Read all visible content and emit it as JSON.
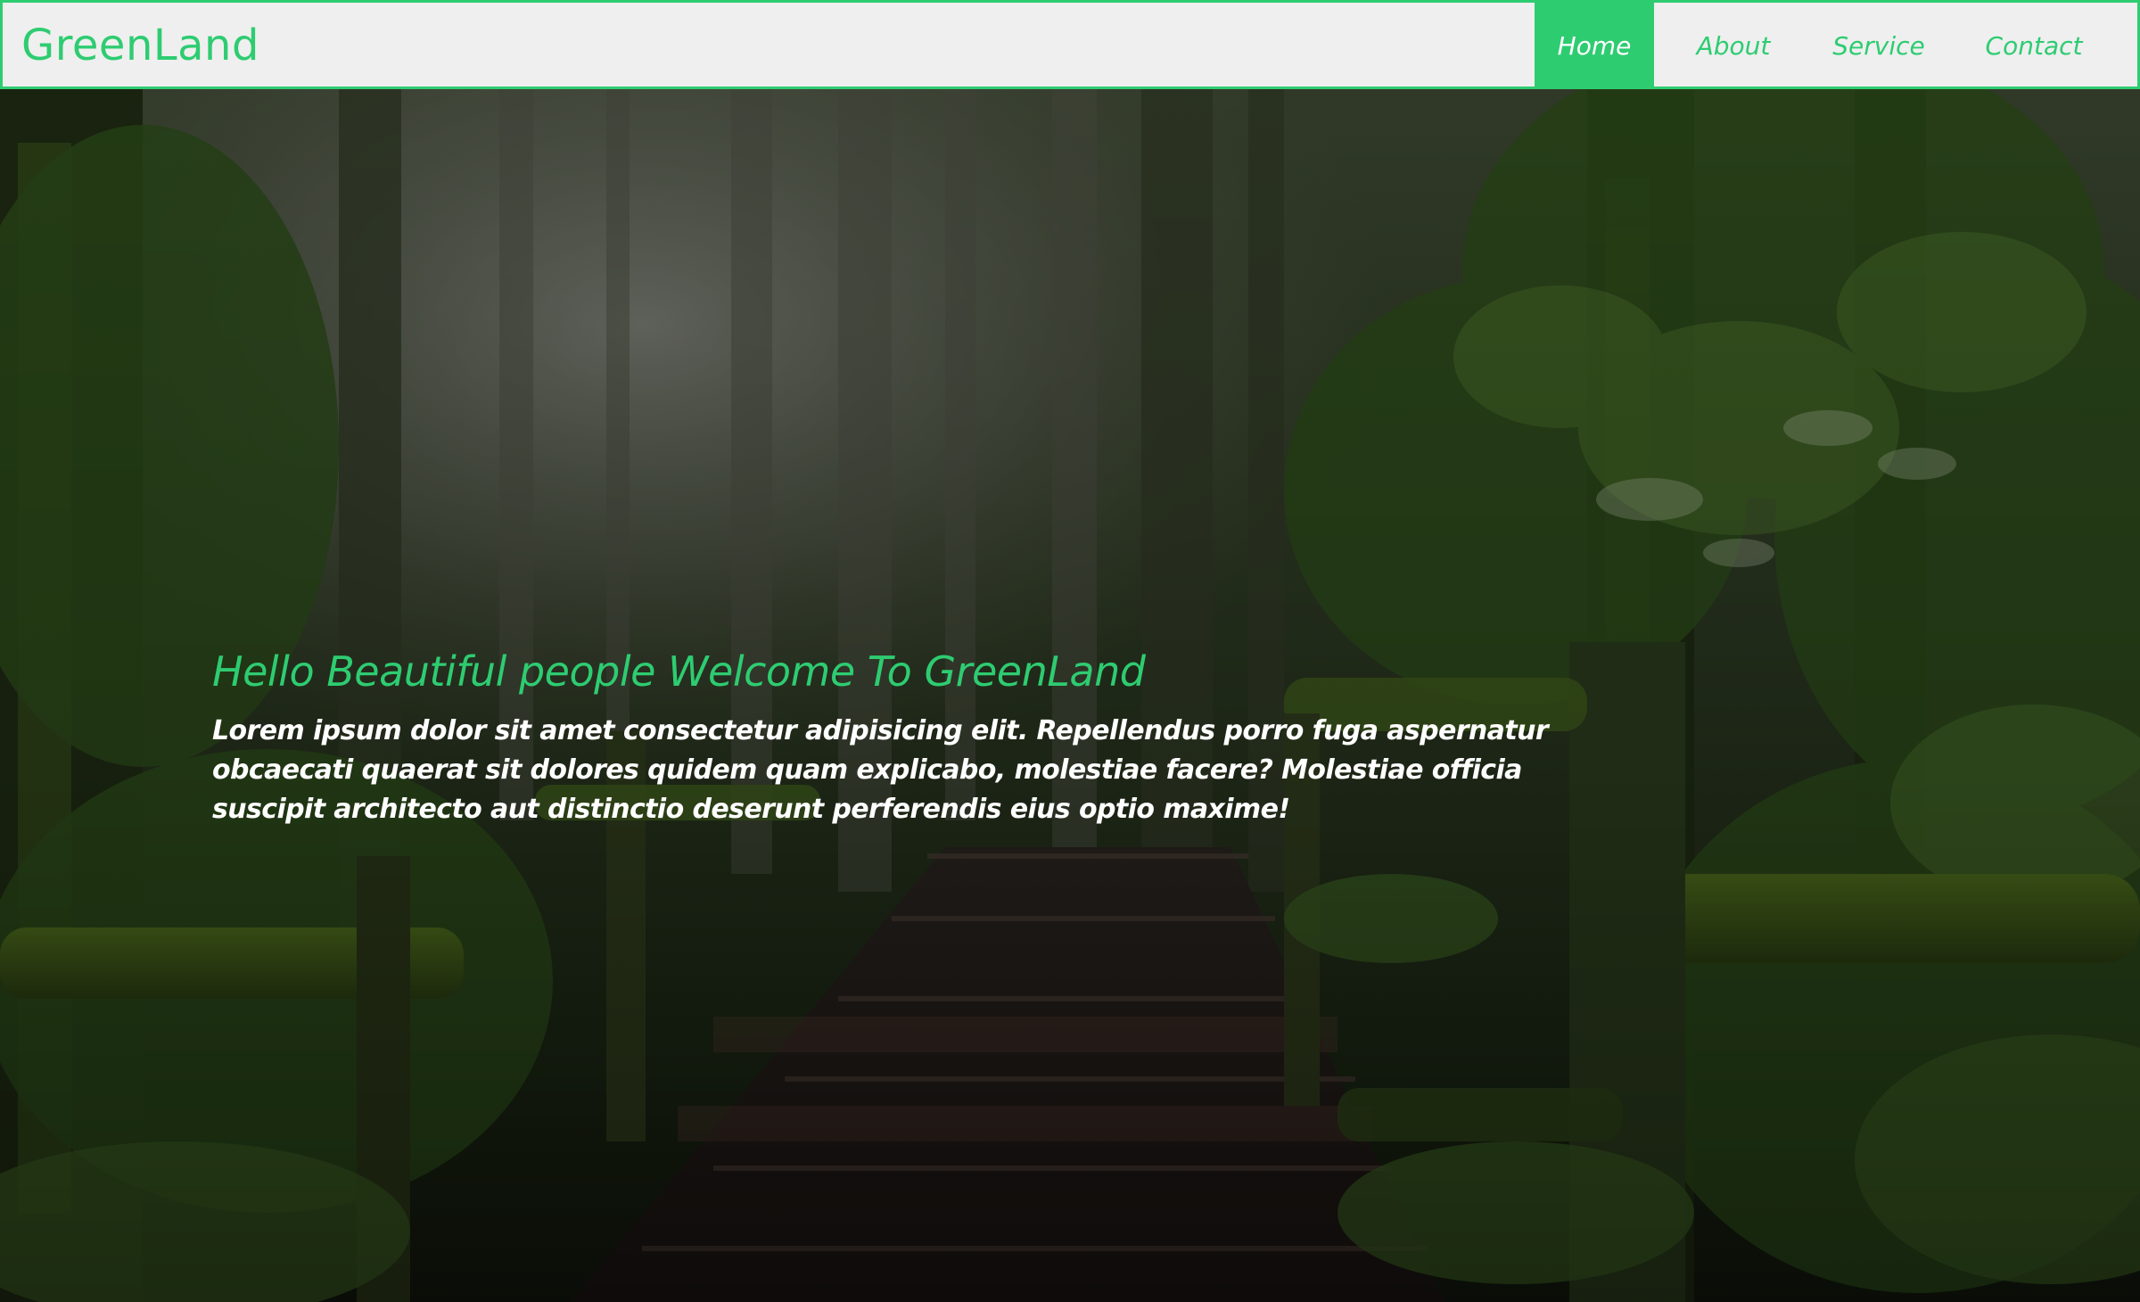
{
  "navbar": {
    "brand": "GreenLand",
    "links": [
      {
        "label": "Home",
        "active": true
      },
      {
        "label": "About",
        "active": false
      },
      {
        "label": "Service",
        "active": false
      },
      {
        "label": "Contact",
        "active": false
      }
    ]
  },
  "hero": {
    "title": "Hello Beautiful people Welcome To GreenLand",
    "body": "Lorem ipsum dolor sit amet consectetur adipisicing elit. Repellendus porro fuga aspernatur obcaecati quaerat sit dolores quidem quam explicabo, molestiae facere? Molestiae officia suscipit architecto aut distinctio deserunt perferendis eius optio maxime!",
    "background_image": "forest-boardwalk-photo"
  },
  "colors": {
    "accent": "#2ecc71",
    "navbar_bg": "#efefef",
    "text_light": "#ffffff"
  }
}
